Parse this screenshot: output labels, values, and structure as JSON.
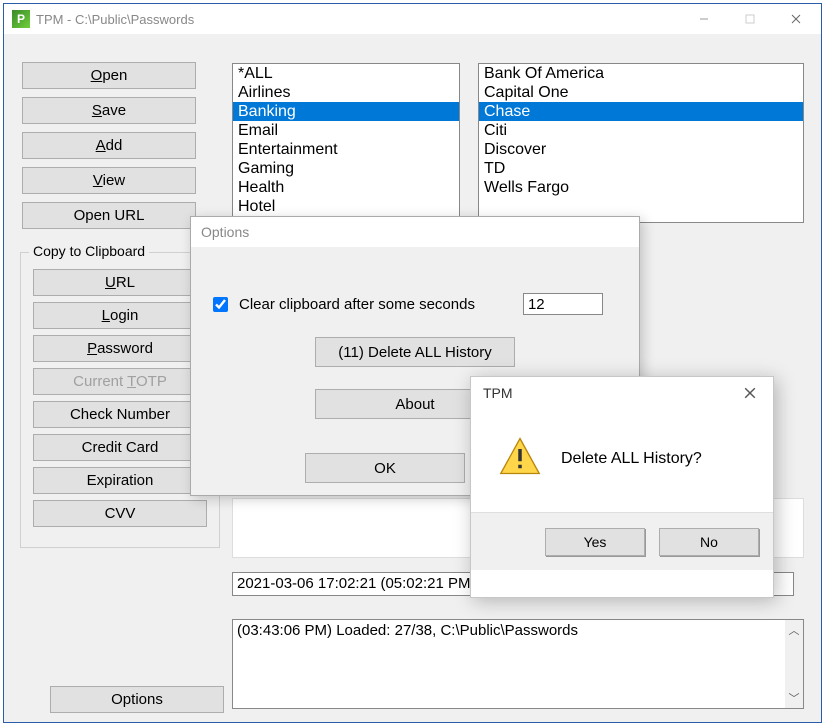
{
  "window": {
    "title": "TPM - C:\\Public\\Passwords",
    "icon_letter": "P"
  },
  "buttons": {
    "open": "Open",
    "open_u": "O",
    "save": "Save",
    "save_u": "S",
    "add": "Add",
    "add_u": "A",
    "view": "View",
    "view_u": "V",
    "open_url": "Open URL"
  },
  "clipboard_group": {
    "label": "Copy to Clipboard",
    "url": "URL",
    "url_u": "U",
    "login": "Login",
    "login_u": "L",
    "password": "Password",
    "password_u": "P",
    "totp": "Current TOTP",
    "totp_u": "T",
    "check_number": "Check Number",
    "credit_card": "Credit Card",
    "expiration": "Expiration",
    "cvv": "CVV"
  },
  "options_button": "Options",
  "categories": [
    "*ALL",
    "Airlines",
    "Banking",
    "Email",
    "Entertainment",
    "Gaming",
    "Health",
    "Hotel"
  ],
  "categories_selected_index": 2,
  "accounts": [
    "Bank Of America",
    "Capital One",
    "Chase",
    "Citi",
    "Discover",
    "TD",
    "Wells Fargo"
  ],
  "accounts_selected_index": 2,
  "status_time": "2021-03-06 17:02:21 (05:02:21 PM",
  "log_line": "(03:43:06 PM) Loaded: 27/38, C:\\Public\\Passwords",
  "options_dialog": {
    "title": "Options",
    "clear_clipboard_label": "Clear clipboard after some seconds",
    "clear_clipboard_checked": true,
    "seconds_value": "12",
    "delete_history": "(11) Delete ALL History",
    "about": "About",
    "ok": "OK"
  },
  "confirm_dialog": {
    "title": "TPM",
    "message": "Delete ALL History?",
    "yes": "Yes",
    "no": "No"
  }
}
